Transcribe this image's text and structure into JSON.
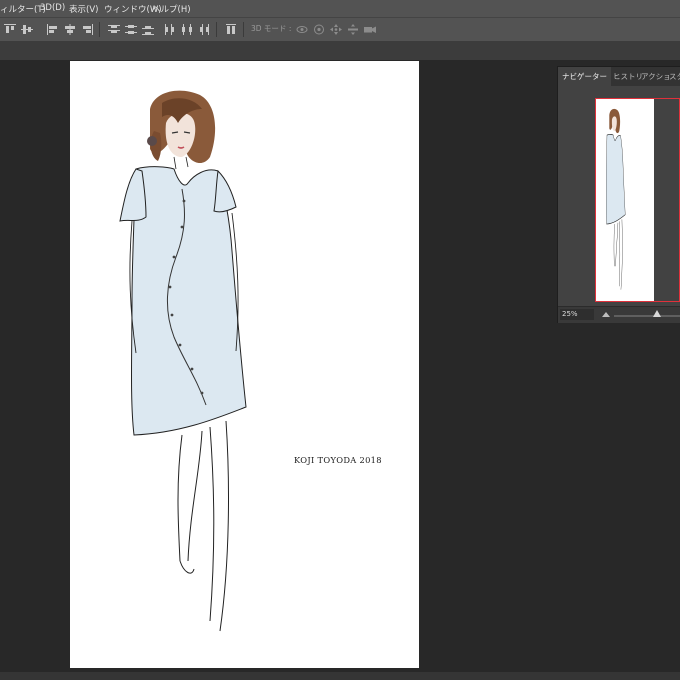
{
  "menu": {
    "filter": "ィルター(T)",
    "threed": "3D(D)",
    "view": "表示(V)",
    "window": "ウィンドウ(W)",
    "help": "ヘルプ(H)"
  },
  "options_bar": {
    "mode_label": "3D モード :"
  },
  "document": {
    "signature": "KOJI TOYODA 2018"
  },
  "navigator_panel": {
    "tabs": [
      "ナビゲーター",
      "ヒストリ",
      "アクショ",
      "スタ"
    ],
    "zoom_value": "25%"
  },
  "colors": {
    "ui_background": "#282828",
    "menu_background": "#535353",
    "panel_background": "#424242",
    "view_box_border": "#e0313b",
    "dress_color": "#dce8f1"
  },
  "icons": [
    "align-top-icon",
    "align-vcenter-icon",
    "align-bottom-icon",
    "align-left-icon",
    "align-hcenter-icon",
    "align-right-icon",
    "distribute-top-icon",
    "distribute-vcenter-icon",
    "distribute-bottom-icon",
    "distribute-left-icon",
    "distribute-hcenter-icon",
    "distribute-right-icon",
    "auto-align-icon",
    "orbit-3d-icon",
    "roll-3d-icon",
    "pan-3d-icon",
    "slide-3d-icon",
    "video-camera-3d-icon"
  ]
}
